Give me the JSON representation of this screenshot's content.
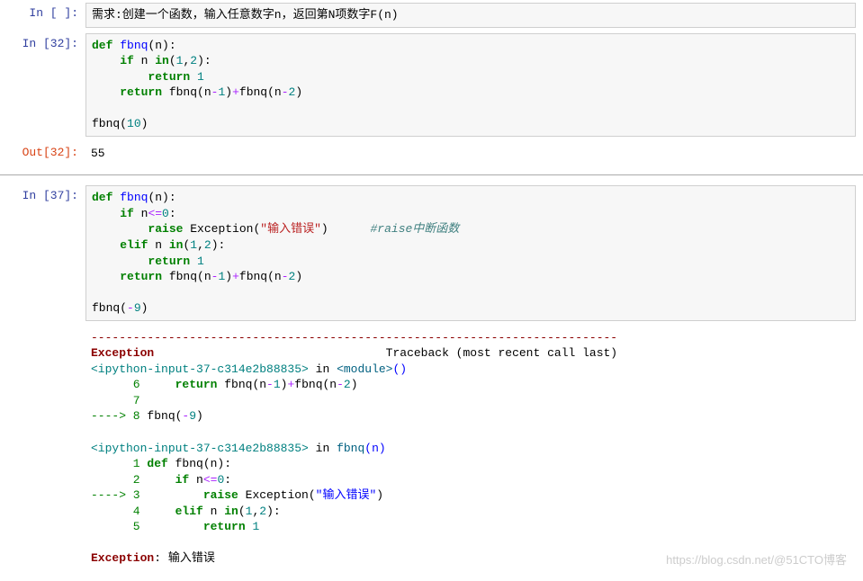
{
  "cells": [
    {
      "type": "in",
      "exec": " ",
      "prompt": "In [ ]:",
      "code_raw": "需求:创建一个函数，输入任意数字n，返回第N项数字F(n)"
    },
    {
      "type": "in",
      "exec": "32",
      "prompt": "In [32]:",
      "code_tokens": [
        [
          {
            "c": "kw",
            "t": "def"
          },
          {
            "t": " "
          },
          {
            "c": "fn",
            "t": "fbnq"
          },
          {
            "t": "(n):"
          }
        ],
        [
          {
            "t": "    "
          },
          {
            "c": "kw",
            "t": "if"
          },
          {
            "t": " n "
          },
          {
            "c": "kw",
            "t": "in"
          },
          {
            "t": "("
          },
          {
            "c": "num",
            "t": "1"
          },
          {
            "t": ","
          },
          {
            "c": "num",
            "t": "2"
          },
          {
            "t": "):"
          }
        ],
        [
          {
            "t": "        "
          },
          {
            "c": "kw",
            "t": "return"
          },
          {
            "t": " "
          },
          {
            "c": "num",
            "t": "1"
          }
        ],
        [
          {
            "t": "    "
          },
          {
            "c": "kw",
            "t": "return"
          },
          {
            "t": " fbnq(n"
          },
          {
            "c": "op",
            "t": "-"
          },
          {
            "c": "num",
            "t": "1"
          },
          {
            "t": ")"
          },
          {
            "c": "op",
            "t": "+"
          },
          {
            "t": "fbnq(n"
          },
          {
            "c": "op",
            "t": "-"
          },
          {
            "c": "num",
            "t": "2"
          },
          {
            "t": ")"
          }
        ],
        [
          {
            "t": ""
          }
        ],
        [
          {
            "t": "fbnq("
          },
          {
            "c": "num",
            "t": "10"
          },
          {
            "t": ")"
          }
        ]
      ]
    },
    {
      "type": "out",
      "exec": "32",
      "prompt": "Out[32]:",
      "output": "55"
    },
    {
      "type": "divider"
    },
    {
      "type": "in",
      "exec": "37",
      "prompt": "In [37]:",
      "code_tokens": [
        [
          {
            "c": "kw",
            "t": "def"
          },
          {
            "t": " "
          },
          {
            "c": "fn",
            "t": "fbnq"
          },
          {
            "t": "(n):"
          }
        ],
        [
          {
            "t": "    "
          },
          {
            "c": "kw",
            "t": "if"
          },
          {
            "t": " n"
          },
          {
            "c": "op",
            "t": "<="
          },
          {
            "c": "num",
            "t": "0"
          },
          {
            "t": ":"
          }
        ],
        [
          {
            "t": "        "
          },
          {
            "c": "kw",
            "t": "raise"
          },
          {
            "t": " Exception("
          },
          {
            "c": "str",
            "t": "\"输入错误\""
          },
          {
            "t": ")      "
          },
          {
            "c": "cm",
            "t": "#raise中断函数"
          }
        ],
        [
          {
            "t": "    "
          },
          {
            "c": "kw",
            "t": "elif"
          },
          {
            "t": " n "
          },
          {
            "c": "kw",
            "t": "in"
          },
          {
            "t": "("
          },
          {
            "c": "num",
            "t": "1"
          },
          {
            "t": ","
          },
          {
            "c": "num",
            "t": "2"
          },
          {
            "t": "):"
          }
        ],
        [
          {
            "t": "        "
          },
          {
            "c": "kw",
            "t": "return"
          },
          {
            "t": " "
          },
          {
            "c": "num",
            "t": "1"
          }
        ],
        [
          {
            "t": "    "
          },
          {
            "c": "kw",
            "t": "return"
          },
          {
            "t": " fbnq(n"
          },
          {
            "c": "op",
            "t": "-"
          },
          {
            "c": "num",
            "t": "1"
          },
          {
            "t": ")"
          },
          {
            "c": "op",
            "t": "+"
          },
          {
            "t": "fbnq(n"
          },
          {
            "c": "op",
            "t": "-"
          },
          {
            "c": "num",
            "t": "2"
          },
          {
            "t": ")"
          }
        ],
        [
          {
            "t": ""
          }
        ],
        [
          {
            "t": "fbnq("
          },
          {
            "c": "op",
            "t": "-"
          },
          {
            "c": "num",
            "t": "9"
          },
          {
            "t": ")"
          }
        ]
      ]
    },
    {
      "type": "traceback",
      "tokens": [
        [
          {
            "c": "dash",
            "t": "---------------------------------------------------------------------------"
          }
        ],
        [
          {
            "c": "err-red",
            "t": "Exception"
          },
          {
            "t": "                                 Traceback (most recent call last)"
          }
        ],
        [
          {
            "c": "tb-darkcyan",
            "t": "<ipython-input-37-c314e2b88835>"
          },
          {
            "t": " in "
          },
          {
            "c": "tb-cyan",
            "t": "<module>"
          },
          {
            "c": "fn",
            "t": "()"
          }
        ],
        [
          {
            "c": "tb-green",
            "t": "      6"
          },
          {
            "t": "     "
          },
          {
            "c": "kw",
            "t": "return"
          },
          {
            "t": " fbnq(n"
          },
          {
            "c": "op",
            "t": "-"
          },
          {
            "c": "num",
            "t": "1"
          },
          {
            "t": ")"
          },
          {
            "c": "op",
            "t": "+"
          },
          {
            "t": "fbnq(n"
          },
          {
            "c": "op",
            "t": "-"
          },
          {
            "c": "num",
            "t": "2"
          },
          {
            "t": ")"
          }
        ],
        [
          {
            "c": "tb-green",
            "t": "      7"
          }
        ],
        [
          {
            "c": "arrow",
            "t": "----> 8"
          },
          {
            "t": " fbnq("
          },
          {
            "c": "op",
            "t": "-"
          },
          {
            "c": "num",
            "t": "9"
          },
          {
            "t": ")"
          }
        ],
        [
          {
            "t": ""
          }
        ],
        [
          {
            "c": "tb-darkcyan",
            "t": "<ipython-input-37-c314e2b88835>"
          },
          {
            "t": " in "
          },
          {
            "c": "tb-cyan",
            "t": "fbnq"
          },
          {
            "c": "fn",
            "t": "(n)"
          }
        ],
        [
          {
            "c": "tb-green",
            "t": "      1"
          },
          {
            "t": " "
          },
          {
            "c": "kw",
            "t": "def"
          },
          {
            "t": " fbnq(n):"
          }
        ],
        [
          {
            "c": "tb-green",
            "t": "      2"
          },
          {
            "t": "     "
          },
          {
            "c": "kw",
            "t": "if"
          },
          {
            "t": " n"
          },
          {
            "c": "op",
            "t": "<="
          },
          {
            "c": "num",
            "t": "0"
          },
          {
            "t": ":"
          }
        ],
        [
          {
            "c": "arrow",
            "t": "----> 3"
          },
          {
            "t": "         "
          },
          {
            "c": "kw",
            "t": "raise"
          },
          {
            "t": " Exception("
          },
          {
            "c": "fn",
            "t": "\"输入错误\""
          },
          {
            "t": ")"
          }
        ],
        [
          {
            "c": "tb-green",
            "t": "      4"
          },
          {
            "t": "     "
          },
          {
            "c": "kw",
            "t": "elif"
          },
          {
            "t": " n "
          },
          {
            "c": "kw",
            "t": "in"
          },
          {
            "t": "("
          },
          {
            "c": "num",
            "t": "1"
          },
          {
            "t": ","
          },
          {
            "c": "num",
            "t": "2"
          },
          {
            "t": "):"
          }
        ],
        [
          {
            "c": "tb-green",
            "t": "      5"
          },
          {
            "t": "         "
          },
          {
            "c": "kw",
            "t": "return"
          },
          {
            "t": " "
          },
          {
            "c": "num",
            "t": "1"
          }
        ],
        [
          {
            "t": ""
          }
        ],
        [
          {
            "c": "err-red",
            "t": "Exception"
          },
          {
            "t": ": 输入错误"
          }
        ]
      ]
    }
  ],
  "watermark": "https://blog.csdn.net/@51CTO博客"
}
